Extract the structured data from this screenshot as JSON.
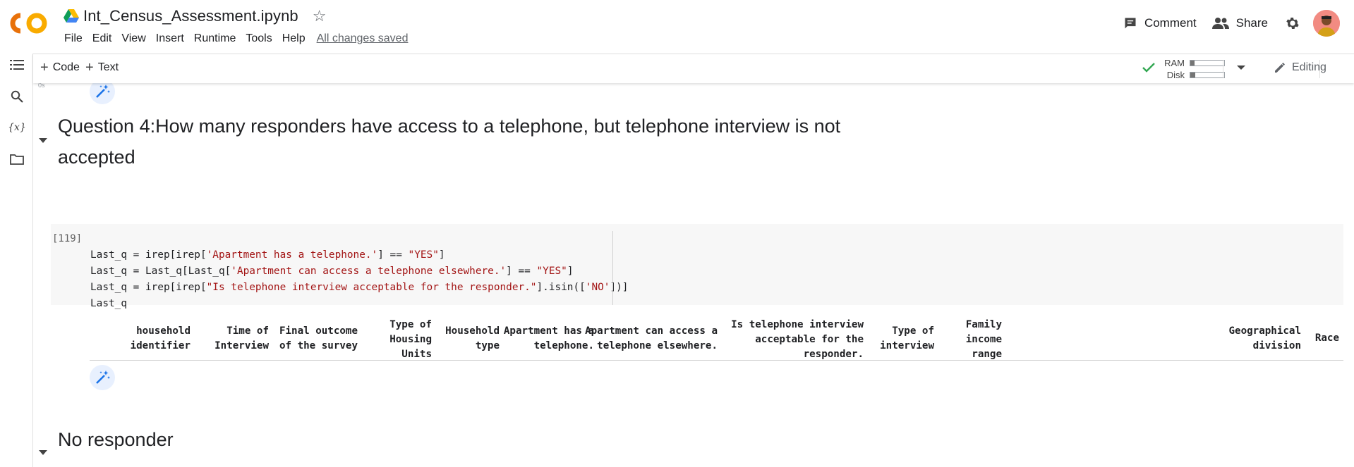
{
  "app": {
    "notebook_title": "Int_Census_Assessment.ipynb",
    "menu": [
      "File",
      "Edit",
      "View",
      "Insert",
      "Runtime",
      "Tools",
      "Help"
    ],
    "save_status": "All changes saved",
    "comment_label": "Comment",
    "share_label": "Share"
  },
  "toolbar": {
    "code_label": "Code",
    "text_label": "Text",
    "ram_label": "RAM",
    "disk_label": "Disk",
    "ram_usage": 0.12,
    "disk_usage": 0.14,
    "editing_label": "Editing"
  },
  "sidebar": {
    "items": [
      "table-of-contents-icon",
      "search-icon",
      "variables-icon",
      "files-icon"
    ],
    "variables_glyph": "{x}"
  },
  "cells": {
    "prev_exec_time": "0s",
    "question_heading": "Question 4:How many responders have access to a telephone, but telephone interview is not accepted",
    "question_heading_line1": "Question 4:How many responders have access to a telephone, but telephone interview is not",
    "question_heading_line2": "accepted",
    "code_cell": {
      "exec_count": "[119]",
      "lines": [
        {
          "a": "Last_q = irep[irep[",
          "s": "'Apartment has a telephone.'",
          "b": "] == ",
          "s2": "\"YES\"",
          "c": "]"
        },
        {
          "a": "Last_q = Last_q[Last_q[",
          "s": "'Apartment can access a telephone elsewhere.'",
          "b": "] == ",
          "s2": "\"YES\"",
          "c": "]"
        },
        {
          "a": "Last_q = irep[irep[",
          "s": "\"Is telephone interview acceptable for the responder.\"",
          "b": "].isin([",
          "s2": "'NO'",
          "c": "])]"
        },
        {
          "a": "Last_q",
          "s": "",
          "b": "",
          "s2": "",
          "c": ""
        }
      ]
    },
    "output_columns": [
      [
        "household",
        "identifier"
      ],
      [
        "Time of",
        "Interview"
      ],
      [
        "Final outcome",
        "of the survey"
      ],
      [
        "Type of",
        "Housing",
        "Units"
      ],
      [
        "Household",
        "type"
      ],
      [
        "Apartment has a",
        "telephone."
      ],
      [
        "Apartment can access a",
        "telephone elsewhere."
      ],
      [
        "Is telephone interview",
        "acceptable for the",
        "responder."
      ],
      [
        "Type of",
        "interview"
      ],
      [
        "Family",
        "income",
        "range"
      ],
      [
        "Geographical",
        "division"
      ],
      [
        "Race"
      ]
    ],
    "next_heading": "No responder"
  },
  "colors": {
    "accent_orange": "#F9AB00",
    "string_red": "#a31515",
    "check_green": "#34a853"
  }
}
